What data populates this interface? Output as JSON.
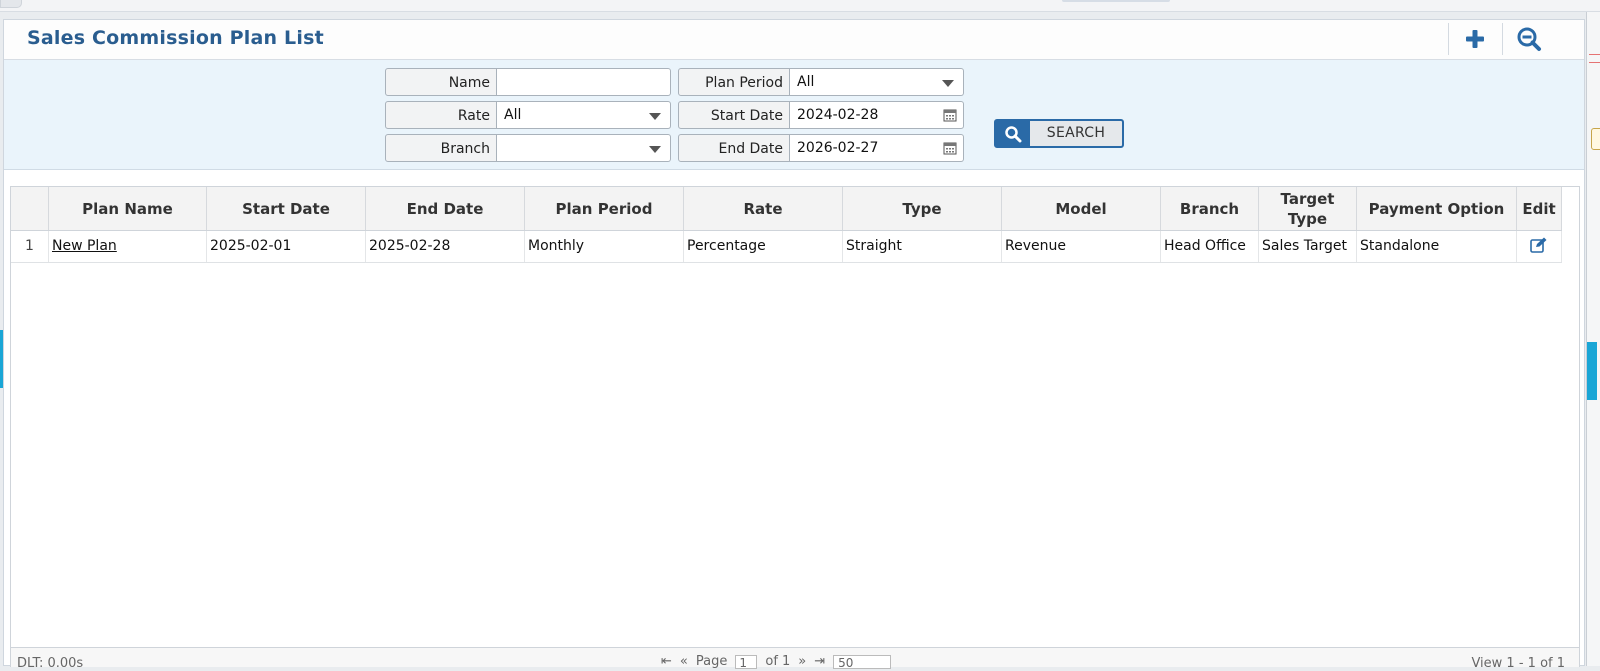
{
  "page": {
    "title": "Sales Commission Plan List"
  },
  "toolbar": {
    "add_icon": "plus-icon",
    "zoom_icon": "zoom-out-icon"
  },
  "filters": {
    "name": {
      "label": "Name",
      "value": ""
    },
    "plan_period": {
      "label": "Plan Period",
      "value": "All"
    },
    "rate": {
      "label": "Rate",
      "value": "All"
    },
    "start_date": {
      "label": "Start Date",
      "value": "2024-02-28"
    },
    "branch": {
      "label": "Branch",
      "value": ""
    },
    "end_date": {
      "label": "End Date",
      "value": "2026-02-27"
    },
    "search_label": "SEARCH"
  },
  "table": {
    "columns": [
      "",
      "Plan Name",
      "Start Date",
      "End Date",
      "Plan Period",
      "Rate",
      "Type",
      "Model",
      "Branch",
      "Target Type",
      "Payment Option",
      "Edit"
    ],
    "rows": [
      {
        "num": "1",
        "plan_name": "New Plan",
        "start_date": "2025-02-01",
        "end_date": "2025-02-28",
        "plan_period": "Monthly",
        "rate": "Percentage",
        "type": "Straight",
        "model": "Revenue",
        "branch": "Head Office",
        "target_type": "Sales Target",
        "payment_option": "Standalone"
      }
    ]
  },
  "pager": {
    "left_text": "DLT: 0.00s",
    "page_label": "Page",
    "page_value": "1",
    "of_label": "of 1",
    "per_page": "50",
    "view_text": "View 1 - 1 of 1"
  },
  "colors": {
    "accent": "#2a6aa7",
    "title": "#2a5d8f",
    "filter_bg": "#eaf4fb"
  }
}
